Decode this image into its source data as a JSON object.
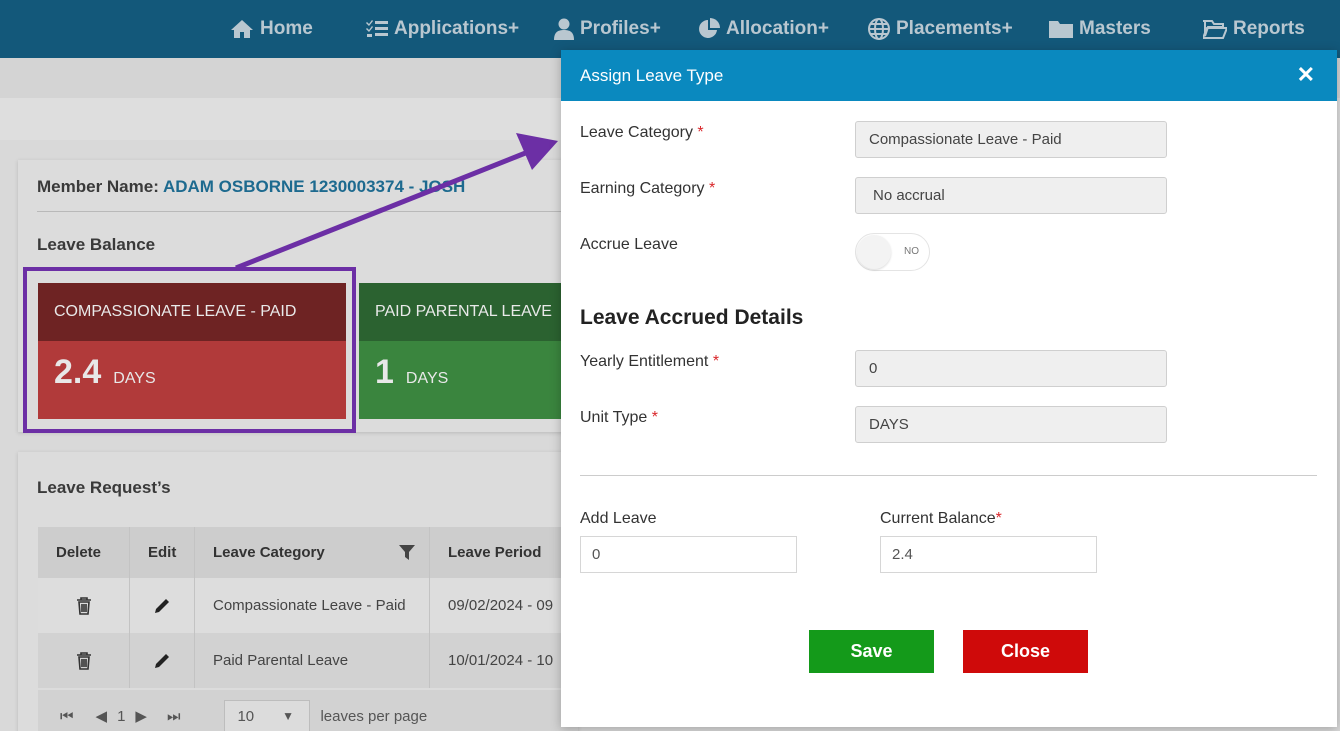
{
  "nav": {
    "items": [
      {
        "label": "Home",
        "icon": "home-icon"
      },
      {
        "label": "Applications+",
        "icon": "list-check-icon"
      },
      {
        "label": "Profiles+",
        "icon": "user-icon"
      },
      {
        "label": "Allocation+",
        "icon": "pie-chart-icon"
      },
      {
        "label": "Placements+",
        "icon": "globe-icon"
      },
      {
        "label": "Masters",
        "icon": "folder-icon"
      },
      {
        "label": "Reports",
        "icon": "folder-open-icon"
      }
    ]
  },
  "member": {
    "label": "Member Name:",
    "value": "ADAM OSBORNE 1230003374 - JOSH"
  },
  "leave_balance": {
    "title": "Leave Balance",
    "cards": [
      {
        "name": "COMPASSIONATE LEAVE - PAID",
        "value": "2.4",
        "unit": "DAYS",
        "color": "#b13a3a"
      },
      {
        "name": "PAID PARENTAL LEAVE",
        "value": "1",
        "unit": "DAYS",
        "color": "#3a853e"
      }
    ]
  },
  "leave_requests": {
    "title": "Leave Request’s",
    "columns": [
      "Delete",
      "Edit",
      "Leave Category",
      "Leave Period"
    ],
    "rows": [
      {
        "category": "Compassionate Leave - Paid",
        "period": "09/02/2024 - 09"
      },
      {
        "category": "Paid Parental Leave",
        "period": "10/01/2024 - 10"
      }
    ],
    "pager": {
      "page": "1",
      "page_size": "10",
      "suffix": "leaves per page"
    }
  },
  "modal": {
    "title": "Assign Leave Type",
    "fields": {
      "leave_category": {
        "label": "Leave Category",
        "value": "Compassionate Leave - Paid"
      },
      "earning_category": {
        "label": "Earning Category",
        "value": "No accrual"
      },
      "accrue_leave": {
        "label": "Accrue Leave",
        "toggle": "NO"
      },
      "section": "Leave Accrued Details",
      "yearly_entitlement": {
        "label": "Yearly Entitlement",
        "value": "0"
      },
      "unit_type": {
        "label": "Unit Type",
        "value": "DAYS"
      },
      "add_leave": {
        "label": "Add Leave",
        "value": "0"
      },
      "current_balance": {
        "label": "Current Balance",
        "value": "2.4"
      }
    },
    "required_mark": "*",
    "buttons": {
      "save": "Save",
      "close": "Close"
    }
  },
  "colors": {
    "nav": "#13587a",
    "modal_header": "#0a89bf",
    "save": "#149a1a",
    "close": "#cf0a0a",
    "highlight": "#6c2fa5"
  }
}
